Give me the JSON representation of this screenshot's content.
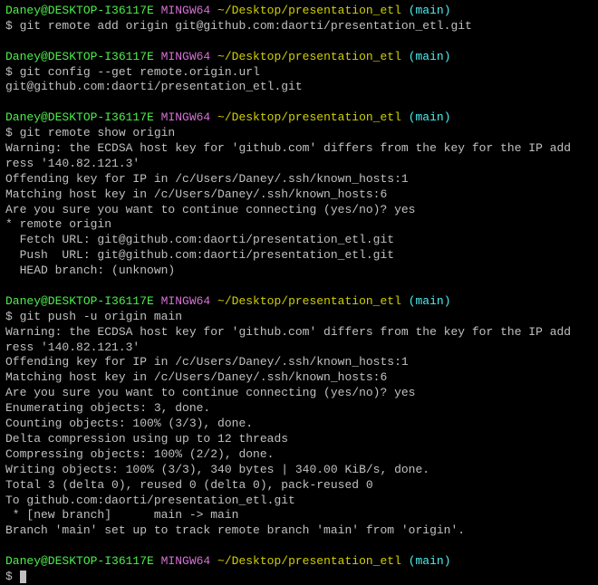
{
  "prompt": {
    "user": "Daney@DESKTOP-I36117E",
    "host": " MINGW64",
    "path": " ~/Desktop/presentation_etl",
    "branch": " (main)"
  },
  "blocks": [
    {
      "command": "$ git remote add origin git@github.com:daorti/presentation_etl.git",
      "output": []
    },
    {
      "command": "$ git config --get remote.origin.url",
      "output": [
        "git@github.com:daorti/presentation_etl.git"
      ]
    },
    {
      "command": "$ git remote show origin",
      "output": [
        "Warning: the ECDSA host key for 'github.com' differs from the key for the IP add",
        "ress '140.82.121.3'",
        "Offending key for IP in /c/Users/Daney/.ssh/known_hosts:1",
        "Matching host key in /c/Users/Daney/.ssh/known_hosts:6",
        "Are you sure you want to continue connecting (yes/no)? yes",
        "* remote origin",
        "  Fetch URL: git@github.com:daorti/presentation_etl.git",
        "  Push  URL: git@github.com:daorti/presentation_etl.git",
        "  HEAD branch: (unknown)"
      ]
    },
    {
      "command": "$ git push -u origin main",
      "output": [
        "Warning: the ECDSA host key for 'github.com' differs from the key for the IP add",
        "ress '140.82.121.3'",
        "Offending key for IP in /c/Users/Daney/.ssh/known_hosts:1",
        "Matching host key in /c/Users/Daney/.ssh/known_hosts:6",
        "Are you sure you want to continue connecting (yes/no)? yes",
        "Enumerating objects: 3, done.",
        "Counting objects: 100% (3/3), done.",
        "Delta compression using up to 12 threads",
        "Compressing objects: 100% (2/2), done.",
        "Writing objects: 100% (3/3), 340 bytes | 340.00 KiB/s, done.",
        "Total 3 (delta 0), reused 0 (delta 0), pack-reused 0",
        "To github.com:daorti/presentation_etl.git",
        " * [new branch]      main -> main",
        "Branch 'main' set up to track remote branch 'main' from 'origin'."
      ]
    }
  ],
  "final_command_prefix": "$ "
}
